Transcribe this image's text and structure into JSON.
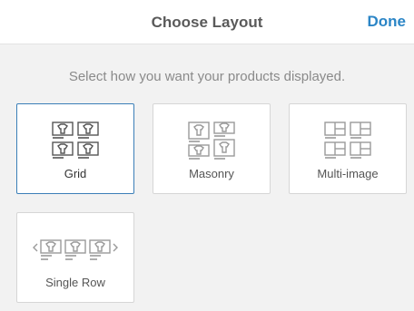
{
  "header": {
    "title": "Choose Layout",
    "done_label": "Done"
  },
  "subtitle": "Select how you want your products displayed.",
  "options": [
    {
      "label": "Grid",
      "icon": "grid-layout-icon",
      "selected": true
    },
    {
      "label": "Masonry",
      "icon": "masonry-layout-icon",
      "selected": false
    },
    {
      "label": "Multi-image",
      "icon": "multi-image-layout-icon",
      "selected": false
    },
    {
      "label": "Single Row",
      "icon": "single-row-layout-icon",
      "selected": false
    }
  ],
  "colors": {
    "accent": "#2b85c6",
    "selected_border": "#3b7fb8"
  }
}
